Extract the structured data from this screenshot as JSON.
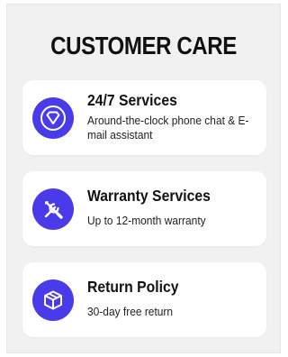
{
  "header": {
    "title": "CUSTOMER CARE"
  },
  "colors": {
    "accent": "#4a3bea",
    "panel_bg": "#f1f1f1",
    "card_bg": "#ffffff"
  },
  "cards": [
    {
      "icon": "diamond-icon",
      "title": "24/7 Services",
      "description": "Around-the-clock phone chat & E-mail assistant"
    },
    {
      "icon": "tools-icon",
      "title": "Warranty Services",
      "description": "Up to 12-month warranty"
    },
    {
      "icon": "box-icon",
      "title": "Return Policy",
      "description": "30-day free return"
    }
  ]
}
